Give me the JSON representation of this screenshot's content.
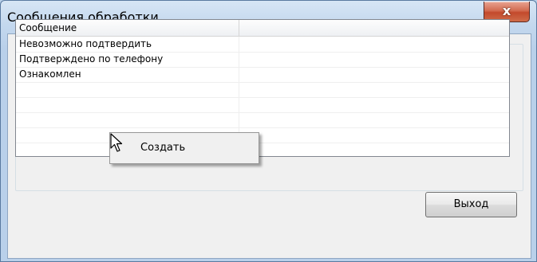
{
  "window": {
    "title": "Сообщения обработки",
    "close_label": "x"
  },
  "list": {
    "columns": [
      "Сообщение",
      ""
    ],
    "rows": [
      "Невозможно подтвердить",
      "Подтверждено по телефону",
      "Ознакомлен",
      "",
      "",
      "",
      "",
      ""
    ]
  },
  "context_menu": {
    "items": [
      "Создать"
    ]
  },
  "buttons": {
    "exit": "Выход"
  },
  "icons": {
    "cursor": "mouse-pointer-icon",
    "close": "close-icon"
  }
}
